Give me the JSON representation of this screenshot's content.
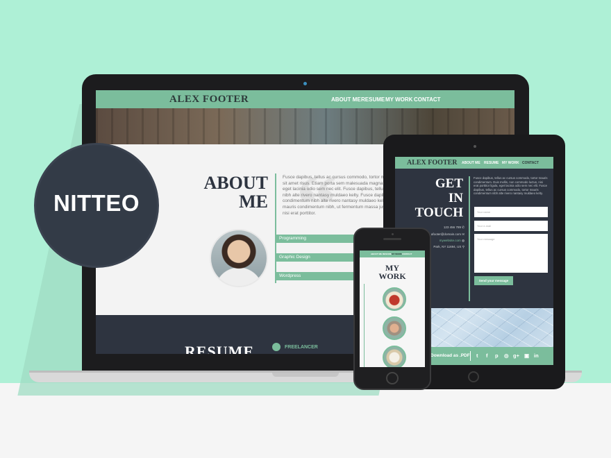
{
  "badge": {
    "text": "NITTEO"
  },
  "laptop_site": {
    "brand": "ALEX FOOTER",
    "nav": [
      "ABOUT ME",
      "RESUME",
      "MY WORK",
      "CONTACT"
    ],
    "about_title_1": "ABOUT",
    "about_title_2": "ME",
    "about_text": "Fusce dapibus, tellus ac cursus commodo, tortor mauris condimentum nibh, ut fermentum massa justo sit amet risus. Etiam porta sem malesuada magna mollis, non commodo luctus, nisi erat porttitor ligula, eget lacinia odio sem nec elit. Fusce dapibus, tellus ac cursus commodo, tortor mauris condimentum nibh alte rivero nantasy muldaeo kelty. Fusce dapibus, tellus ac cursus commodo, tortor mauris condimentum nibh alte rivero nantasy muldaeo kelty. Fusce dapibus, tellus ac cursus commodo, tortor mauris condimentum nibh, ut fermentum massa justo sit amet risus. Duis mollis, non commodo luctus, nisi erat porttitor.",
    "skills": [
      "Programming",
      "Graphic Design",
      "Wordpress"
    ],
    "resume_title": "RESUME",
    "freelancer": "FREELANCER"
  },
  "tablet_site": {
    "brand": "ALEX FOOTER",
    "nav": [
      "ABOUT ME",
      "RESUME",
      "MY WORK",
      "CONTACT"
    ],
    "contact_title_1": "GET",
    "contact_title_2": "IN",
    "contact_title_3": "TOUCH",
    "contact_text": "Fusce dapibus, tellus ac cursus commodo, tortor mauris condimentum. Duis mollis, non commodo luctus, nisi erat porttitor ligula, eget lacinia odio sem nec elit. Fusce dapibus, tellus ac cursus commodo, tortor mauris condimentum nibh alte rivero nantasy muldaeo kelty.",
    "phone": "123 456 789",
    "email": "afooter@domain.com",
    "website": "mywebsite.com",
    "address": "Park, NY 11694, US",
    "name_placeholder": "Your name",
    "email_placeholder": "Your e-mail",
    "message_placeholder": "Your message",
    "send_label": "Send your message",
    "download_label": "Download as .PDF",
    "social": [
      "t",
      "f",
      "p",
      "◎",
      "g+",
      "▣",
      "in"
    ]
  },
  "phone_site": {
    "nav": [
      "ABOUT ME",
      "RESUME",
      "MY WORK",
      "CONTACT"
    ],
    "work_title_1": "MY",
    "work_title_2": "WORK"
  },
  "colors": {
    "mint_bg": "#aef0d6",
    "accent": "#7bbd9c",
    "dark": "#2e3440",
    "badge": "#333b47"
  }
}
